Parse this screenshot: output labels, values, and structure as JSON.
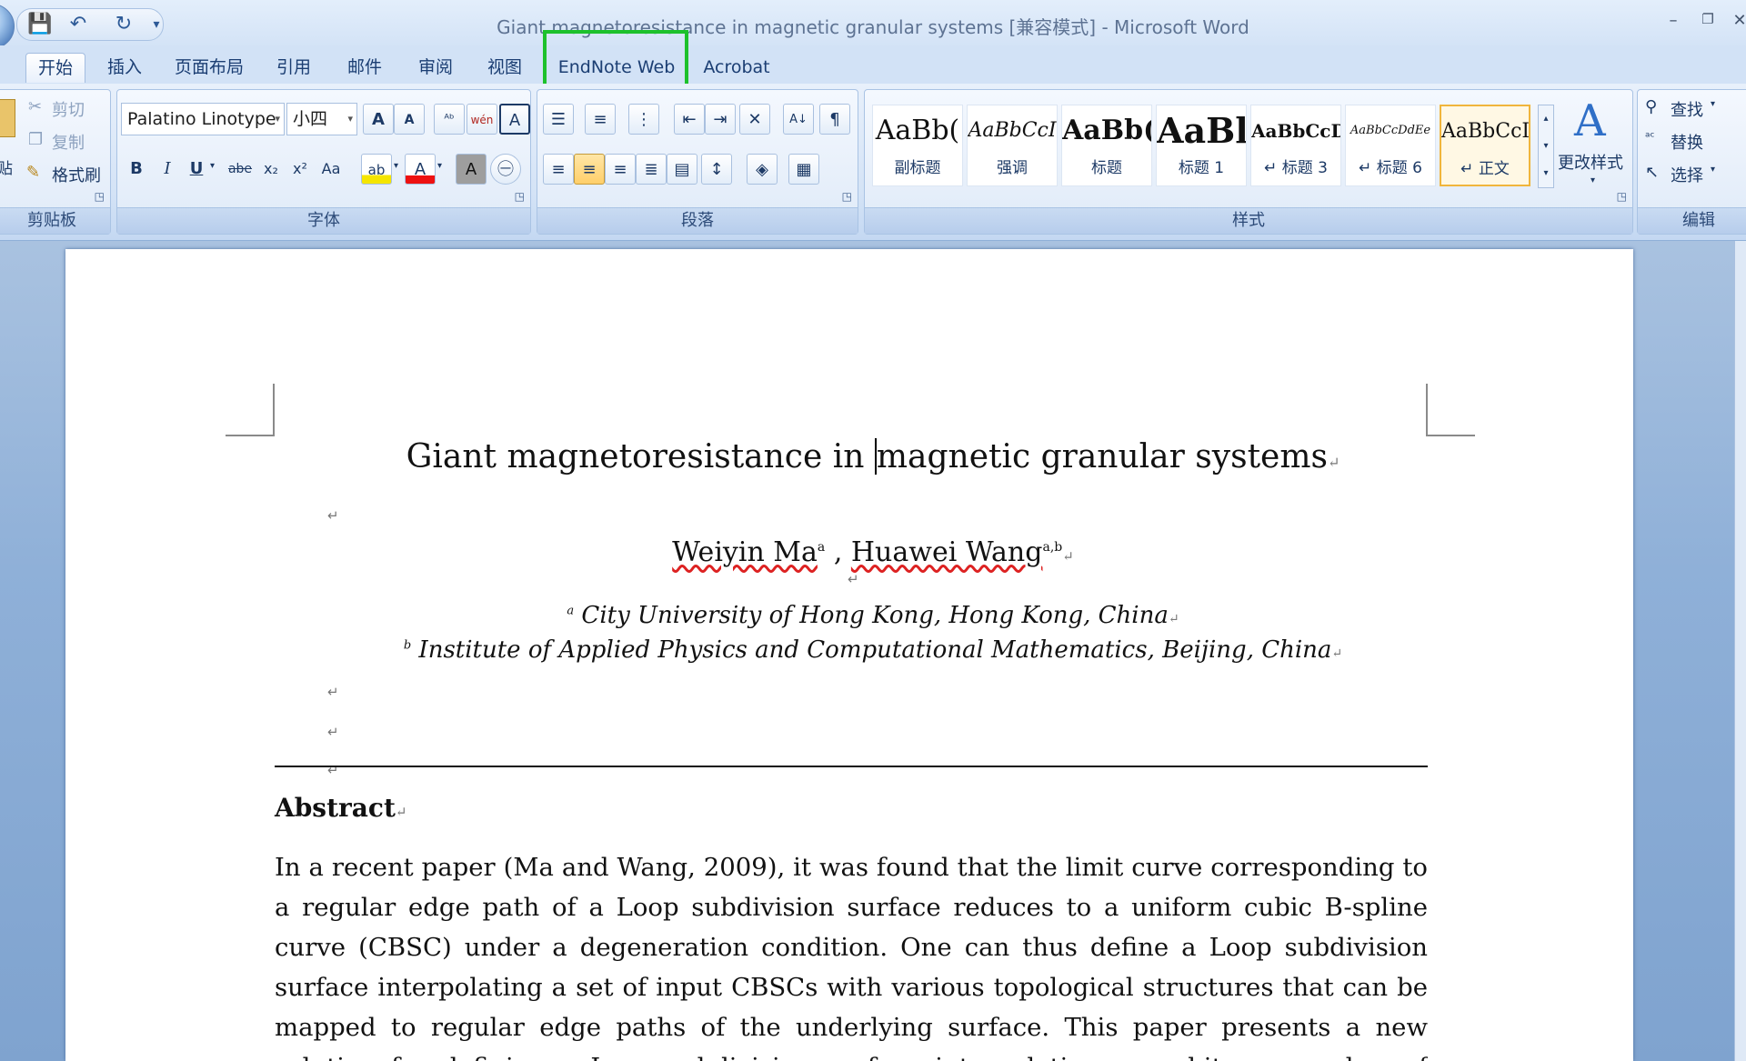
{
  "window": {
    "title": "Giant magnetoresistance in magnetic granular systems [兼容模式] - Microsoft Word",
    "minimize": "–",
    "restore": "❐",
    "close": "✕"
  },
  "qat": {
    "save": "💾",
    "undo": "↶",
    "redo": "↻",
    "more": "▾"
  },
  "tabs": [
    "开始",
    "插入",
    "页面布局",
    "引用",
    "邮件",
    "审阅",
    "视图",
    "EndNote Web",
    "Acrobat"
  ],
  "clipboard": {
    "paste": "贴",
    "cut": "剪切",
    "copy": "复制",
    "format_painter": "格式刷",
    "label": "剪贴板"
  },
  "font": {
    "name": "Palatino Linotype",
    "size": "小四",
    "grow": "A",
    "shrink": "A",
    "bold": "B",
    "italic": "I",
    "underline": "U",
    "strike": "abe",
    "subscript": "x₂",
    "superscript": "x²",
    "case": "Aa",
    "highlight": "ab",
    "color": "A",
    "char_shade": "A",
    "enclose": "㊀",
    "phonetic": "wén",
    "border": "A",
    "label": "字体"
  },
  "paragraph": {
    "label": "段落"
  },
  "styles": {
    "label": "样式",
    "items": [
      {
        "sample": "AaBb(",
        "name": "副标题"
      },
      {
        "sample": "AaBbCcI",
        "name": "强调"
      },
      {
        "sample": "AaBb(",
        "name": "标题"
      },
      {
        "sample": "AaBl",
        "name": "标题 1"
      },
      {
        "sample": "AaBbCcD",
        "name": "↵ 标题 3"
      },
      {
        "sample": "AaBbCcDdEe",
        "name": "↵ 标题 6"
      },
      {
        "sample": "AaBbCcI",
        "name": "↵ 正文"
      }
    ],
    "change_styles": "更改样式"
  },
  "editing": {
    "find": "查找",
    "replace": "替换",
    "select": "选择",
    "label": "编辑"
  },
  "document": {
    "title_before_cursor": "Giant magnetoresistance in ",
    "title_after_cursor": "magnetic granular systems",
    "author1": "Weiyin Ma",
    "author1_sup": "a",
    "author_sep": " , ",
    "author2": "Huawei Wang",
    "author2_sup": "a,b",
    "aff1_mark": "a",
    "aff1": "City University of Hong Kong, Hong Kong, China",
    "aff2_mark": "b",
    "aff2": "Institute of Applied Physics and Computational Mathematics, Beijing, China",
    "para_mark": "↵",
    "abstract_heading": "Abstract",
    "abstract_text": "In a recent paper (Ma and Wang, 2009), it was found that the limit curve corresponding to a regular edge path of a Loop subdivision surface reduces to a uniform cubic B-spline curve (CBSC) under a degeneration condition. One can thus define a Loop subdivision surface interpolating a set of input CBSCs with various topological structures that can be mapped to regular edge paths of the underlying surface. This paper presents a new solution for defining a Loop subdivision surface interpolating an arbitrary number of CBSCs meeting at an extraordinary point. The solution is"
  }
}
